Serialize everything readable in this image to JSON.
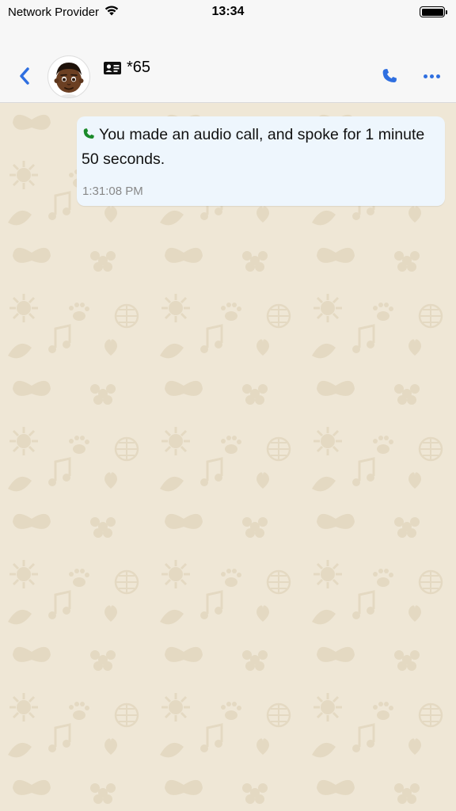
{
  "status_bar": {
    "carrier": "Network Provider",
    "time": "13:34",
    "wifi_icon": "wifi-icon",
    "battery_icon": "battery-icon"
  },
  "header": {
    "back_icon": "chevron-left-icon",
    "contact_name": "*65",
    "contact_card_icon": "contact-card-icon",
    "call_icon": "phone-icon",
    "more_icon": "ellipsis-icon",
    "accent_color": "#2f6fe0"
  },
  "messages": [
    {
      "type": "call-log",
      "icon": "phone-icon",
      "icon_color": "#1a8a2a",
      "text": "You made an audio call, and spoke for 1 minute 50 seconds.",
      "time": "1:31:08 PM",
      "outgoing": true
    }
  ],
  "chat_background_color": "#efe7d6"
}
